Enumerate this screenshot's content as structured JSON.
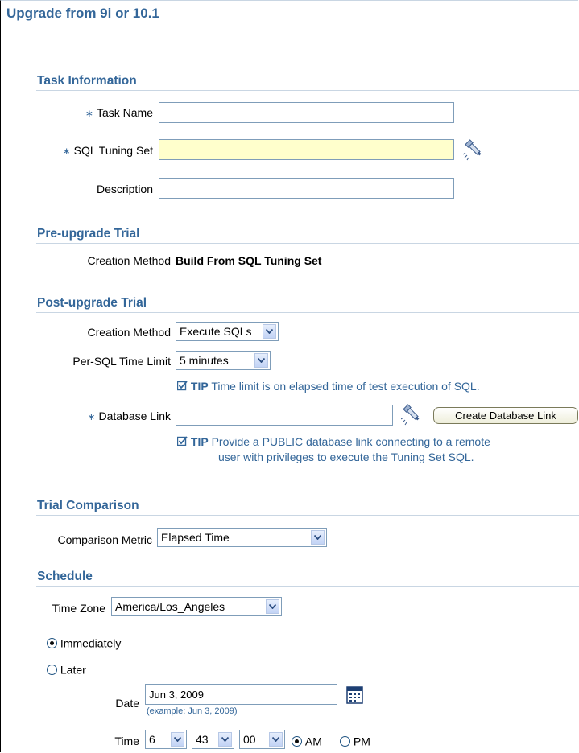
{
  "page_title": "Upgrade from 9i or 10.1",
  "task_info": {
    "heading": "Task Information",
    "task_name_label": "Task Name",
    "task_name_value": "",
    "sql_tuning_set_label": "SQL Tuning Set",
    "sql_tuning_set_value": "",
    "description_label": "Description",
    "description_value": "",
    "required_marker": "∗"
  },
  "pre_upgrade": {
    "heading": "Pre-upgrade Trial",
    "creation_method_label": "Creation Method",
    "creation_method_value": "Build From SQL Tuning Set"
  },
  "post_upgrade": {
    "heading": "Post-upgrade Trial",
    "creation_method_label": "Creation Method",
    "creation_method_value": "Execute SQLs",
    "time_limit_label": "Per-SQL Time Limit",
    "time_limit_value": "5 minutes",
    "tip_word": "TIP",
    "tip1_text": "Time limit is on elapsed time of test execution of SQL.",
    "database_link_label": "Database Link",
    "database_link_value": "",
    "create_db_link_button": "Create Database Link",
    "tip2_line1": "Provide a PUBLIC database link connecting to a remote",
    "tip2_line2": "user with privileges to execute the Tuning Set SQL."
  },
  "trial_comparison": {
    "heading": "Trial Comparison",
    "metric_label": "Comparison Metric",
    "metric_value": "Elapsed Time"
  },
  "schedule": {
    "heading": "Schedule",
    "time_zone_label": "Time Zone",
    "time_zone_value": "America/Los_Angeles",
    "immediately_label": "Immediately",
    "later_label": "Later",
    "immediately_selected": true,
    "date_label": "Date",
    "date_value": "Jun 3, 2009",
    "date_hint": "(example: Jun 3, 2009)",
    "time_label": "Time",
    "hour_value": "6",
    "minute_value": "43",
    "second_value": "00",
    "am_label": "AM",
    "pm_label": "PM",
    "am_selected": true
  },
  "colors": {
    "heading_blue": "#336699",
    "required_field_yellow": "#ffffcc",
    "rule_color": "#c9d6e3"
  },
  "icons": {
    "search": "flashlight-search-icon",
    "calendar": "calendar-icon"
  }
}
